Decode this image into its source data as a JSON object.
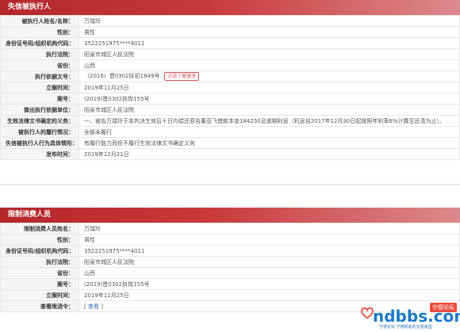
{
  "section1": {
    "title": "失信被执行人",
    "rows": [
      {
        "label": "被执行人姓名/名称：",
        "value": "万瑞玲"
      },
      {
        "label": "性别：",
        "value": "男性"
      },
      {
        "label": "身份证号码/组织机构代码：",
        "value": "3522251975****4011"
      },
      {
        "label": "执行法院：",
        "value": "阳泉市城区人民法院"
      },
      {
        "label": "省份：",
        "value": "山西"
      },
      {
        "label": "执行依据文号：",
        "value": "（2018）晋0302民初1849号",
        "tag": "点击了解更多"
      },
      {
        "label": "立案时间：",
        "value": "2019年11月25日"
      },
      {
        "label": "案号：",
        "value": "(2019)晋0302执恢155号"
      },
      {
        "label": "做出执行依据单位：",
        "value": "阳泉市城区人民法院"
      },
      {
        "label": "生效法律文书确定的义务：",
        "value": "一、被告万瑞玲于本判决生效后十日内偿还原告董亚飞借款本金184250及逾期利息（利息自2017年12月30日起按照年利率6%计算至还清为止）。"
      },
      {
        "label": "被执行人的履行情况：",
        "value": "全部未履行"
      },
      {
        "label": "失信被执行人行为具体情形：",
        "value": "有履行能力而拒不履行生效法律文书确定义务"
      },
      {
        "label": "发布时间：",
        "value": "2019年12月21日"
      }
    ]
  },
  "section2": {
    "title": "限制消费人员",
    "rows": [
      {
        "label": "限制消费人员姓名：",
        "value": "万瑞玲"
      },
      {
        "label": "性别：",
        "value": "男性"
      },
      {
        "label": "身份证号码/组织机构代码：",
        "value": "3522251975****4011"
      },
      {
        "label": "执行法院：",
        "value": "阳泉市城区人民法院"
      },
      {
        "label": "省份：",
        "value": "山西"
      },
      {
        "label": "案号：",
        "value": "(2019)晋0302执恢155号"
      },
      {
        "label": "立案时间：",
        "value": "2019年11月25日"
      },
      {
        "label": "查看限消令：",
        "value": "查看",
        "is_link": true
      }
    ]
  },
  "watermark": {
    "logo_text": "ndbbs.com",
    "badge": "宁德论坛",
    "subtitle": "宁德论坛 宁德网友的交流家园"
  },
  "colors": {
    "header_red": "#b4272b",
    "tag_red": "#d9534f",
    "link_blue": "#2b6cb0"
  }
}
